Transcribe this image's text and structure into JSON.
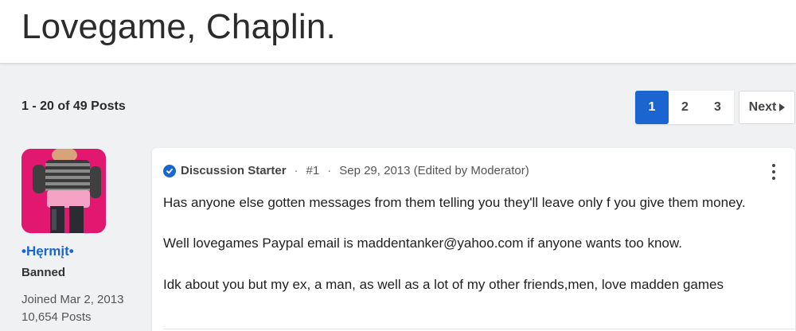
{
  "header": {
    "title": "Lovegame, Chaplin."
  },
  "pagination": {
    "summary": "1 - 20 of 49 Posts",
    "pages": [
      "1",
      "2",
      "3"
    ],
    "active_page": "1",
    "next_label": "Next"
  },
  "author": {
    "name": "•Hęrmįt•",
    "role": "Banned",
    "joined": "Joined Mar 2, 2013",
    "posts": "10,654 Posts"
  },
  "post": {
    "badge": "Discussion Starter",
    "number": "#1",
    "date": "Sep 29, 2013 (Edited by Moderator)",
    "lines": [
      "Has anyone else gotten messages from them telling you they'll leave only f you give them money.",
      "Well lovegames Paypal email is maddentanker@yahoo.com if anyone wants too know.",
      "Idk about you but my ex, a man, as well as a lot of my other friends,men, love madden games"
    ]
  },
  "colors": {
    "accent": "#1a65d0",
    "avatar_bg": "#e2176f"
  },
  "icons": {
    "verified": "check-circle-icon",
    "menu": "more-vertical-icon",
    "next": "triangle-right-icon"
  }
}
